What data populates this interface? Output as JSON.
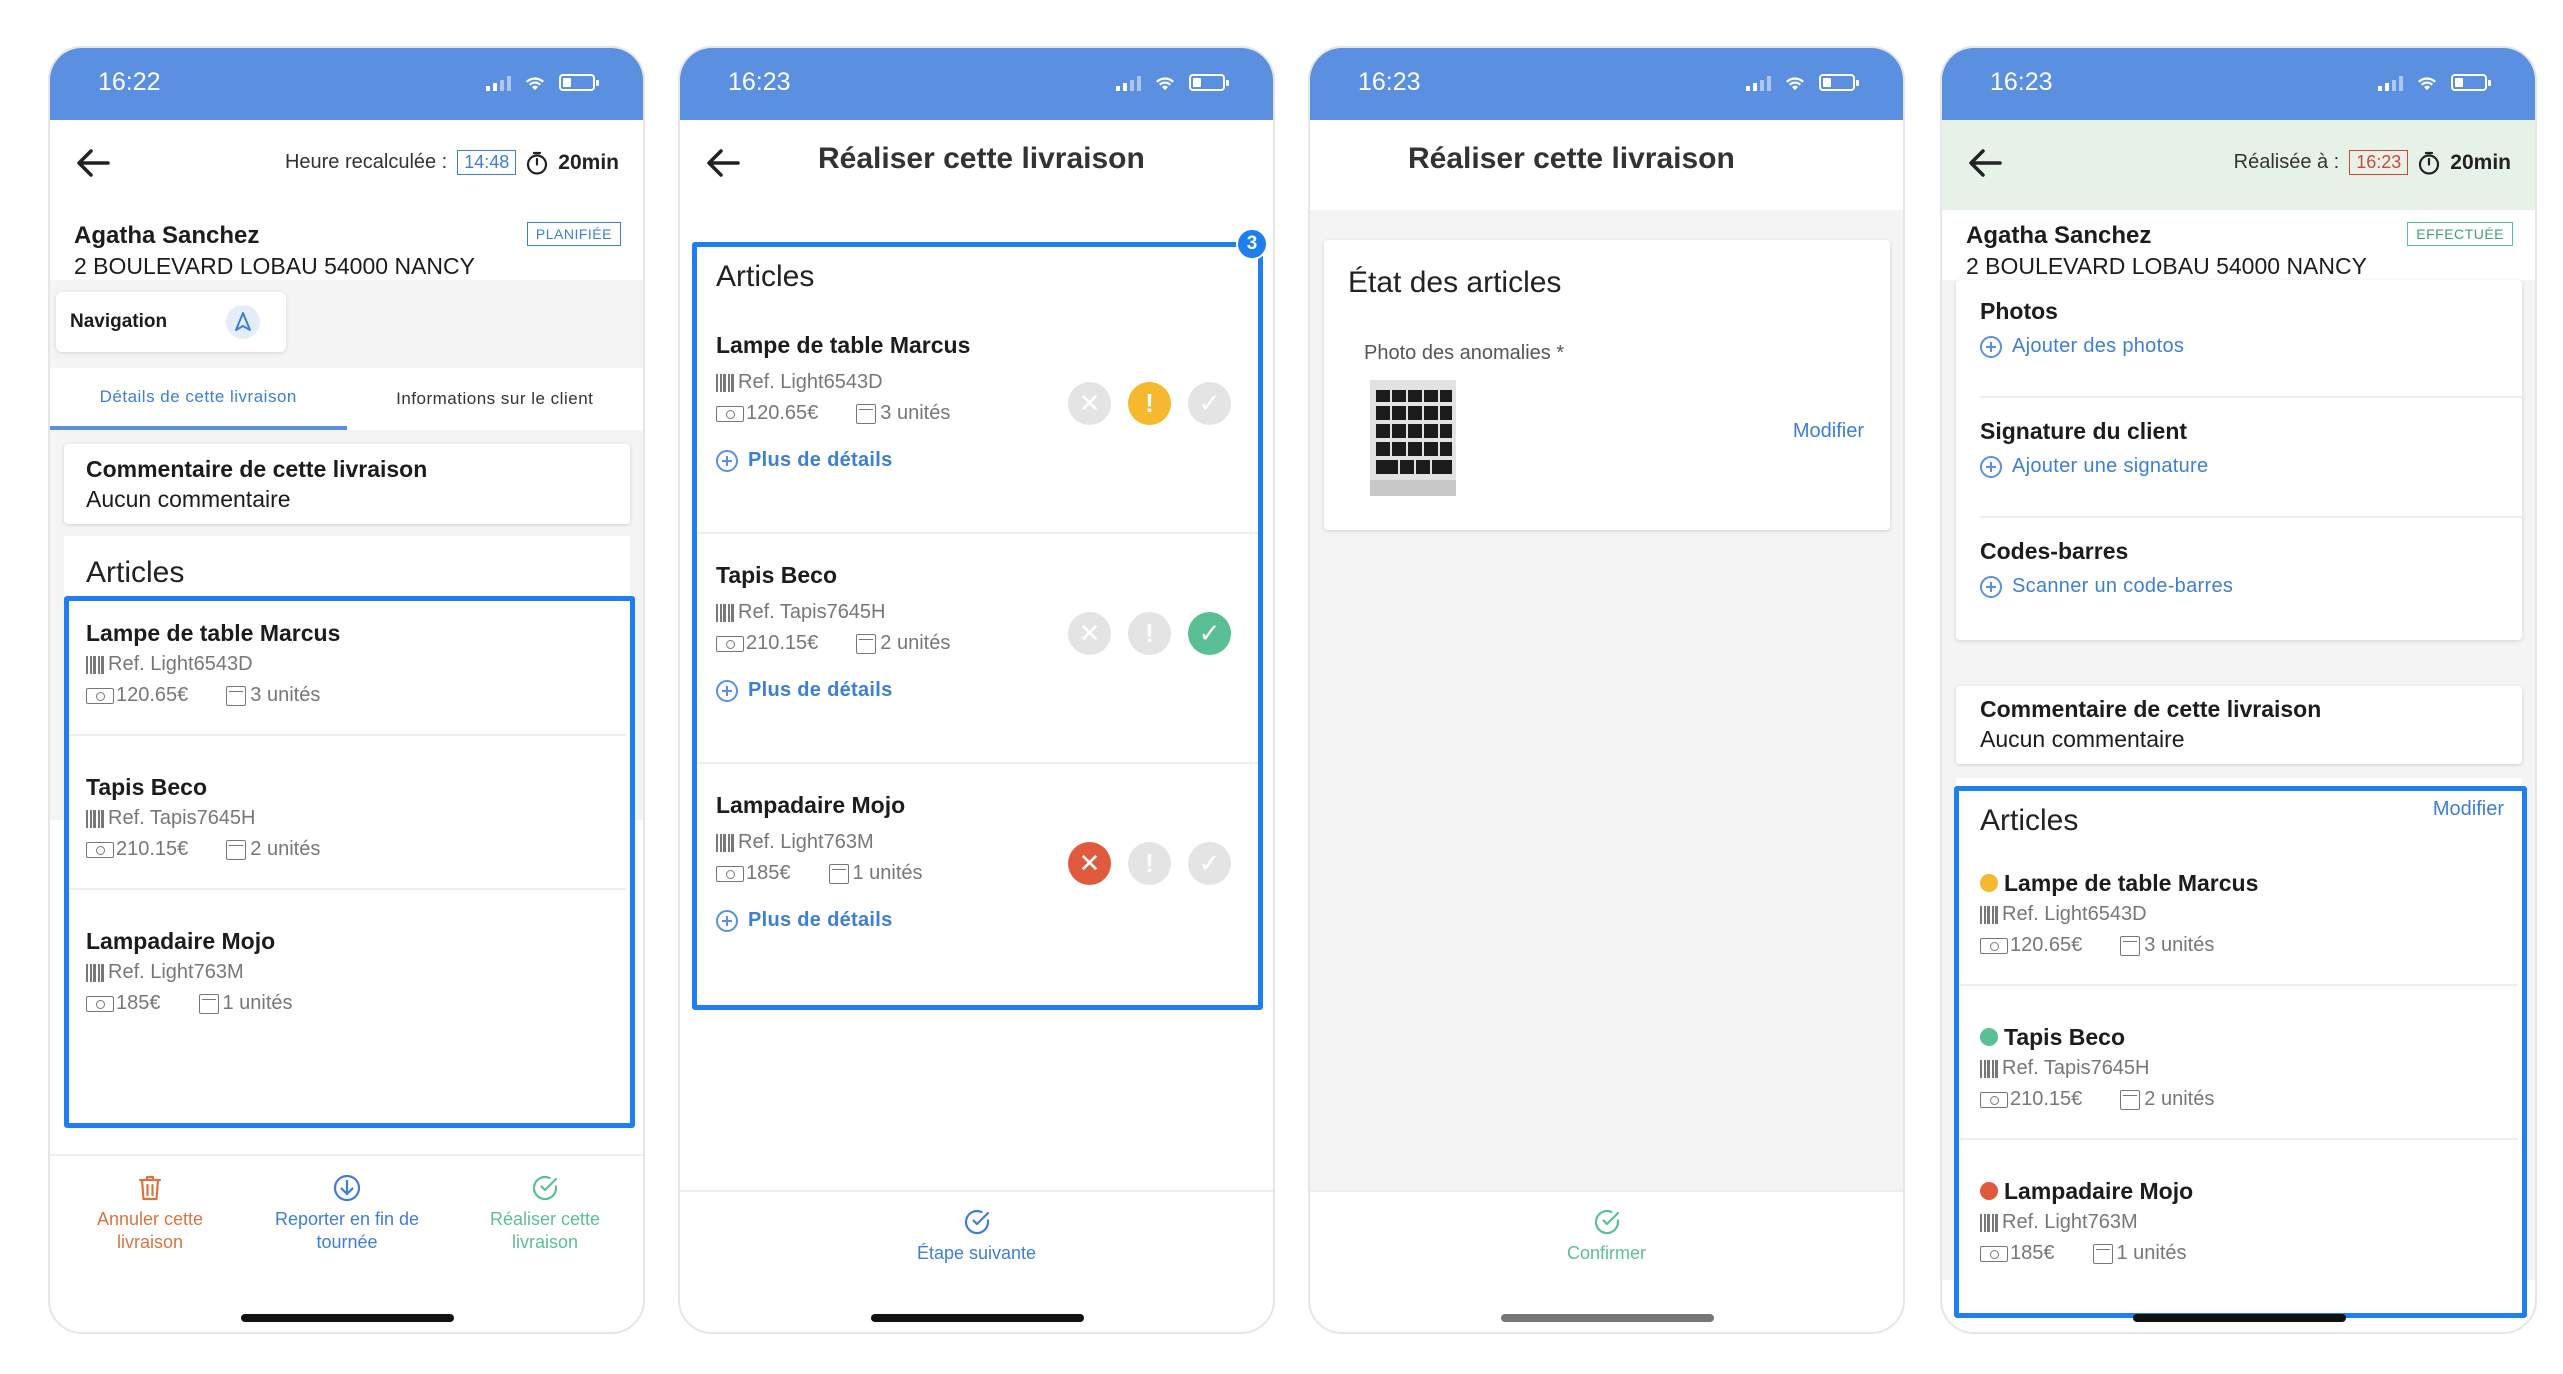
{
  "screens": [
    {
      "time": "16:22",
      "header": {
        "label": "Heure recalculée :",
        "time_box": "14:48",
        "duration": "20min"
      },
      "client": {
        "name": "Agatha Sanchez",
        "address": "2 BOULEVARD LOBAU 54000 NANCY",
        "badge": "PLANIFIÉE"
      },
      "navigation_label": "Navigation",
      "tabs": [
        "Détails de cette livraison",
        "Informations sur le client"
      ],
      "comment": {
        "title": "Commentaire de cette livraison",
        "text": "Aucun commentaire"
      },
      "articles_title": "Articles",
      "actions": [
        {
          "label": "Annuler cette livraison",
          "icon": "trash-icon",
          "color": "#d9743f"
        },
        {
          "label": "Reporter en fin de tournée",
          "icon": "arrow-down-circle-icon",
          "color": "#3d7ed6"
        },
        {
          "label": "Réaliser cette livraison",
          "icon": "check-circle-icon",
          "color": "#5bbf94"
        }
      ]
    },
    {
      "time": "16:23",
      "title": "Réaliser cette livraison",
      "articles_title": "Articles",
      "badge_count": "3",
      "more_details": "Plus de détails",
      "action": "Étape suivante"
    },
    {
      "time": "16:23",
      "title": "Réaliser cette livraison",
      "section_title": "État des articles",
      "photo_label": "Photo des anomalies *",
      "modify": "Modifier",
      "action": "Confirmer"
    },
    {
      "time": "16:23",
      "header": {
        "label": "Réalisée à :",
        "time_box": "16:23",
        "duration": "20min"
      },
      "client": {
        "name": "Agatha Sanchez",
        "address": "2 BOULEVARD LOBAU 54000 NANCY",
        "badge": "EFFECTUÉE"
      },
      "sections": [
        {
          "title": "Photos",
          "link": "Ajouter des photos"
        },
        {
          "title": "Signature du client",
          "link": "Ajouter une signature"
        },
        {
          "title": "Codes-barres",
          "link": "Scanner un code-barres"
        }
      ],
      "comment": {
        "title": "Commentaire de cette livraison",
        "text": "Aucun commentaire"
      },
      "articles_title": "Articles",
      "modify": "Modifier"
    }
  ],
  "articles": [
    {
      "name": "Lampe de table Marcus",
      "ref": "Ref. Light6543D",
      "price": "120.65€",
      "qty": "3 unités",
      "status": "warning"
    },
    {
      "name": "Tapis Beco",
      "ref": "Ref. Tapis7645H",
      "price": "210.15€",
      "qty": "2 unités",
      "status": "ok"
    },
    {
      "name": "Lampadaire Mojo",
      "ref": "Ref. Light763M",
      "price": "185€",
      "qty": "1 unités",
      "status": "error"
    }
  ],
  "colors": {
    "status_bar": "#5b8fe0",
    "highlight": "#1f7ff0",
    "link": "#3d7ed6",
    "warning": "#f5b82e",
    "ok": "#5bbf94",
    "error": "#e05a3e",
    "done_header": "#e6f2e8"
  }
}
